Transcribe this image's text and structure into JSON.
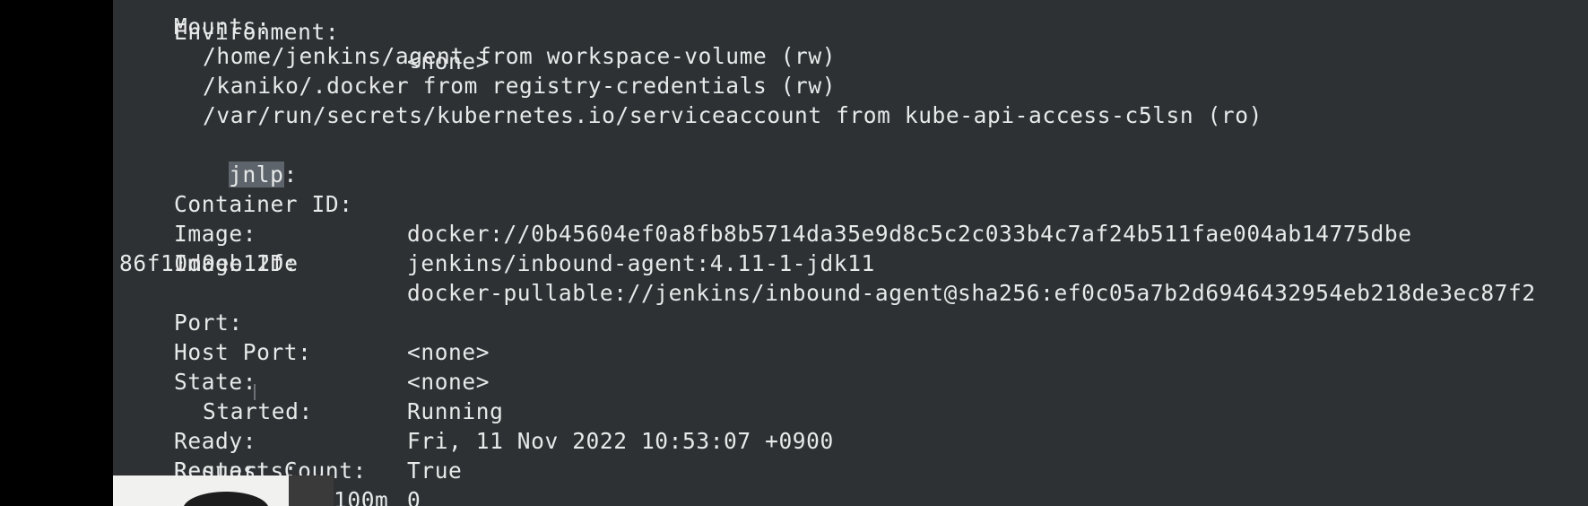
{
  "terminal": {
    "top_partial": {
      "key": "Environment:",
      "value": "<none>"
    },
    "mounts_label": "Mounts:",
    "mounts": [
      "/home/jenkins/agent from workspace-volume (rw)",
      "/kaniko/.docker from registry-credentials (rw)",
      "/var/run/secrets/kubernetes.io/serviceaccount from kube-api-access-c5lsn (ro)"
    ],
    "container_name": "jnlp",
    "container_colon": ":",
    "container_id": {
      "key": "Container ID:",
      "value": "docker://0b45604ef0a8fb8b5714da35e9d8c5c2c033b4c7af24b511fae004ab14775dbe"
    },
    "image": {
      "key": "Image:",
      "value": "jenkins/inbound-agent:4.11-1-jdk11"
    },
    "image_id": {
      "key": "Image ID:",
      "value": "docker-pullable://jenkins/inbound-agent@sha256:ef0c05a7b2d6946432954eb218de3ec87f2",
      "wrap": "86f10d0eb12fe"
    },
    "port": {
      "key": "Port:",
      "value": "<none>"
    },
    "host_port": {
      "key": "Host Port:",
      "value": "<none>"
    },
    "state": {
      "key": "State:",
      "value": "Running"
    },
    "started": {
      "key": "Started:",
      "value": "Fri, 11 Nov 2022 10:53:07 +0900"
    },
    "ready": {
      "key": "Ready:",
      "value": "True"
    },
    "restart_count": {
      "key": "Restart Count:",
      "value": "0"
    },
    "requests_label": "Requests:",
    "cpu_partial_value": "100m"
  }
}
